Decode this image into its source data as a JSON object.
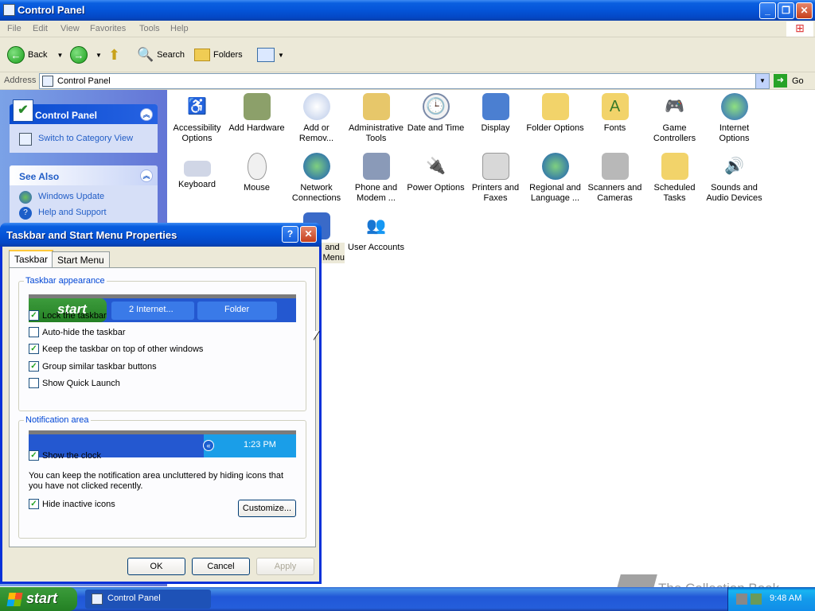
{
  "window": {
    "title": "Control Panel"
  },
  "menu": [
    "File",
    "Edit",
    "View",
    "Favorites",
    "Tools",
    "Help"
  ],
  "toolbar": {
    "back": "Back",
    "search": "Search",
    "folders": "Folders"
  },
  "address": {
    "label": "Address",
    "value": "Control Panel",
    "go": "Go"
  },
  "leftpane": {
    "cp_title": "Control Panel",
    "switch_view": "Switch to Category View",
    "see_also": "See Also",
    "links": [
      "Windows Update",
      "Help and Support"
    ]
  },
  "icons": [
    "Accessibility Options",
    "Add Hardware",
    "Add or Remov...",
    "Administrative Tools",
    "Date and Time",
    "Display",
    "Folder Options",
    "Fonts",
    "Game Controllers",
    "Internet Options",
    "Keyboard",
    "Mouse",
    "Network Connections",
    "Phone and Modem ...",
    "Power Options",
    "Printers and Faxes",
    "Regional and Language ...",
    "Scanners and Cameras",
    "Scheduled Tasks",
    "Sounds and Audio Devices",
    "and Menu",
    "User Accounts"
  ],
  "dialog": {
    "title": "Taskbar and Start Menu Properties",
    "tabs": [
      "Taskbar",
      "Start Menu"
    ],
    "appearance_legend": "Taskbar appearance",
    "preview": {
      "start": "start",
      "item1": "2 Internet...",
      "item2": "Folder"
    },
    "checks": [
      {
        "label": "Lock the taskbar",
        "checked": true
      },
      {
        "label": "Auto-hide the taskbar",
        "checked": false
      },
      {
        "label": "Keep the taskbar on top of other windows",
        "checked": true
      },
      {
        "label": "Group similar taskbar buttons",
        "checked": true
      },
      {
        "label": "Show Quick Launch",
        "checked": false
      }
    ],
    "notif_legend": "Notification area",
    "notif_time": "1:23 PM",
    "show_clock": "Show the clock",
    "notif_text": "You can keep the notification area uncluttered by hiding icons that you have not clicked recently.",
    "hide_inactive": "Hide inactive icons",
    "customize": "Customize...",
    "ok": "OK",
    "cancel": "Cancel",
    "apply": "Apply"
  },
  "taskbar": {
    "start": "start",
    "task": "Control Panel",
    "clock": "9:48 AM"
  },
  "watermark": "The Collection Book"
}
